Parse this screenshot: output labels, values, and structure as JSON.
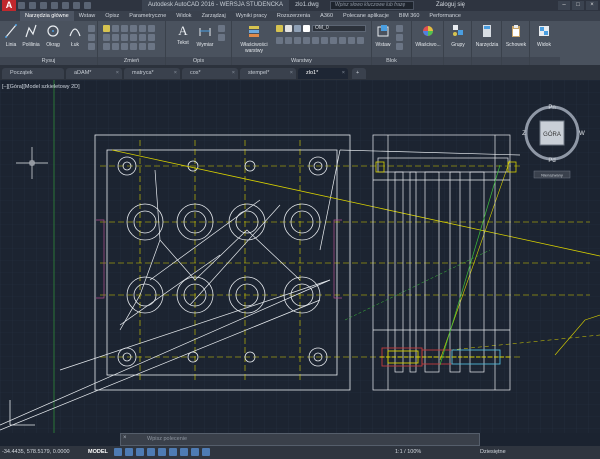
{
  "title_bar": {
    "app_logo": "A",
    "tabs": [
      "Autodesk AutoCAD 2016 - WERSJA STUDENCKA",
      "zlo1.dwg"
    ],
    "search_placeholder": "Wpisz słowo kluczowe lub frazę",
    "login": "Zaloguj się"
  },
  "ribbon_tabs": [
    "Narzędzia główne",
    "Wstaw",
    "Opisz",
    "Parametryczne",
    "Widok",
    "Zarządzaj",
    "Wyniki pracy",
    "Rozszerzenia",
    "A360",
    "Polecane aplikacje",
    "BIM 360",
    "Performance"
  ],
  "ribbon": {
    "rysuj": {
      "label": "Rysuj",
      "buttons": [
        "Linia",
        "Polilinia",
        "Okrąg",
        "Łuk"
      ]
    },
    "zmien": {
      "label": "Zmień"
    },
    "opis": {
      "label": "Opis",
      "buttons": [
        "Tekst",
        "Wymiar"
      ]
    },
    "warstwy": {
      "label": "Warstwy",
      "props_button": "Właściwości warstwy",
      "layer_value": "OM_0"
    },
    "blok": {
      "label": "Blok",
      "buttons": [
        "Wstaw"
      ]
    },
    "wlasciwosci": {
      "button": "Właściwo..."
    },
    "grupy": {
      "button": "Grupy"
    },
    "narzedzia": {
      "button": "Narzędzia"
    },
    "schowek": {
      "button": "Schowek"
    },
    "widok": {
      "button": "Widok"
    }
  },
  "file_tabs": [
    "Początek",
    "aDAM*",
    "matryca*",
    "cos*",
    "stempel*",
    "zlo1*"
  ],
  "viewport": {
    "label": "[–][Góra][Model szkieletowy 2D]",
    "viewcube": {
      "top": "GÓRA",
      "n": "Pn",
      "s": "Pd",
      "e": "W",
      "w": "Z",
      "unnamed": "Nienazwany"
    }
  },
  "command_line": {
    "placeholder": "Wpisz polecenie"
  },
  "status_bar": {
    "coords": "-34.4435, 578.5179, 0.0000",
    "model": "MODEL",
    "scale": "1:1 / 100%",
    "units": "Dziesiętne"
  },
  "colors": {
    "accent": "#c0282d",
    "canvas": "#1c2431",
    "yellow": "#d9d200",
    "white": "#e8ecf0",
    "red": "#c43c3c",
    "green": "#3bbf3b",
    "cyan": "#50b8d8"
  }
}
